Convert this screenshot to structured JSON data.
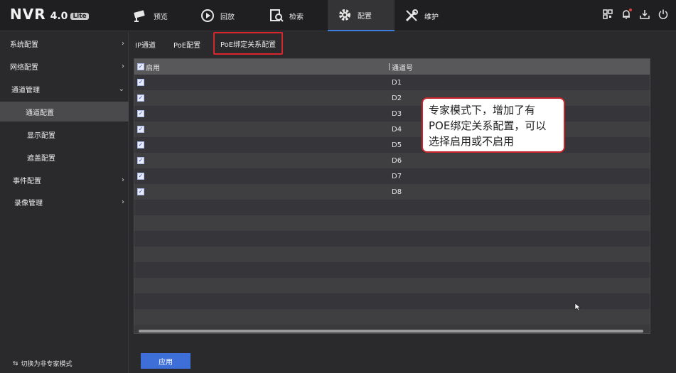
{
  "logo": {
    "brand": "NVR",
    "version": "4.0",
    "edition": "Lite"
  },
  "nav": {
    "preview": "预览",
    "playback": "回放",
    "search": "检索",
    "config": "配置",
    "maintenance": "维护"
  },
  "sidebar": {
    "items": [
      {
        "label": "系统配置"
      },
      {
        "label": "网络配置"
      },
      {
        "label": "通道管理"
      },
      {
        "label": "通道配置"
      },
      {
        "label": "显示配置"
      },
      {
        "label": "遮盖配置"
      },
      {
        "label": "事件配置"
      },
      {
        "label": "录像管理"
      }
    ],
    "footer": "切换为非专家模式"
  },
  "tabs": {
    "ip": "IP通道",
    "poe": "PoE配置",
    "poe_bind": "PoE绑定关系配置"
  },
  "table": {
    "headers": {
      "enable": "启用",
      "channel": "通道号"
    },
    "rows": [
      {
        "channel": "D1",
        "enabled": true
      },
      {
        "channel": "D2",
        "enabled": true
      },
      {
        "channel": "D3",
        "enabled": true
      },
      {
        "channel": "D4",
        "enabled": true
      },
      {
        "channel": "D5",
        "enabled": true
      },
      {
        "channel": "D6",
        "enabled": true
      },
      {
        "channel": "D7",
        "enabled": true
      },
      {
        "channel": "D8",
        "enabled": true
      }
    ]
  },
  "callout": {
    "line1": "专家模式下，增加了有",
    "line2": "POE绑定关系配置，可以",
    "line3": "选择启用或不启用"
  },
  "apply_label": "应用",
  "colors": {
    "accent": "#3e6fd8",
    "highlight": "#d9262c"
  }
}
